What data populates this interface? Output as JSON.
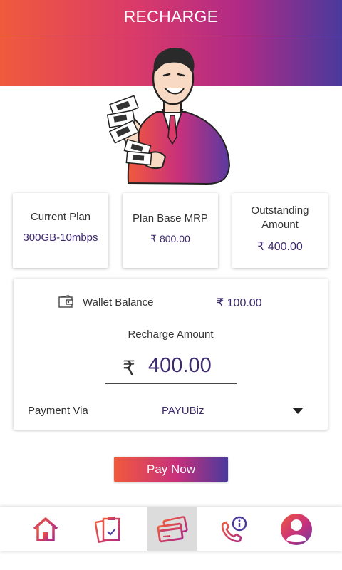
{
  "header": {
    "title": "RECHARGE"
  },
  "cards": {
    "current_plan": {
      "label": "Current Plan",
      "value": "300GB-10mbps"
    },
    "base_mrp": {
      "label": "Plan Base MRP",
      "currency": "₹",
      "value": "800.00"
    },
    "outstanding": {
      "label_line1": "Outstanding",
      "label_line2": "Amount",
      "currency": "₹",
      "value": "400.00"
    }
  },
  "recharge": {
    "wallet_label": "Wallet Balance",
    "wallet_currency": "₹",
    "wallet_value": "100.00",
    "recharge_label": "Recharge Amount",
    "amount_currency": "₹",
    "amount_value": "400.00",
    "pay_via_label": "Payment Via",
    "pay_via_value": "PAYUBiz"
  },
  "actions": {
    "pay_now": "Pay Now"
  },
  "nav": {
    "items": [
      {
        "icon": "home-icon"
      },
      {
        "icon": "clipboard-check-icon"
      },
      {
        "icon": "cards-icon",
        "active": true
      },
      {
        "icon": "phone-info-icon"
      },
      {
        "icon": "profile-icon"
      }
    ]
  },
  "colors": {
    "gradient_start": "#f05a3c",
    "gradient_mid": "#c8307c",
    "gradient_end": "#4a3a9c",
    "value_text": "#3d2a6e",
    "nav_active_bg": "#dcdcdc"
  }
}
